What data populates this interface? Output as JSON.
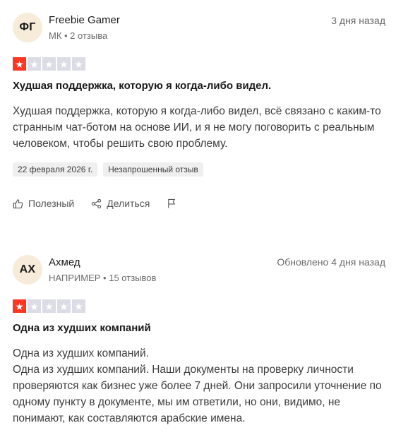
{
  "reviews": [
    {
      "avatar_initials": "ФГ",
      "name": "Freebie Gamer",
      "meta": "МК • 2 отзыва",
      "date": "3 дня назад",
      "rating": 1,
      "title": "Худшая поддержка, которую я когда-либо видел.",
      "body_lines": [
        "Худшая поддержка, которую я когда-либо видел, всё связано с каким-то странным чат-ботом на основе ИИ, и я не могу поговорить с реальным человеком, чтобы решить свою проблему."
      ],
      "tags": [
        "22 февраля 2026 г.",
        "Незапрошенный отзыв"
      ],
      "actions": {
        "useful": "Полезный",
        "share": "Делиться"
      }
    },
    {
      "avatar_initials": "АХ",
      "name": "Ахмед",
      "meta": "НАПРИМЕР • 15 отзывов",
      "date": "Обновлено 4 дня назад",
      "rating": 1,
      "title": "Одна из худших компаний",
      "body_lines": [
        "Одна из худших компаний.",
        "Одна из худших компаний. Наши документы на проверку личности проверяются как бизнес уже более 7 дней. Они запросили уточнение по одному пункту в документе, мы им ответили, но они, видимо, не понимают, как составляются арабские имена."
      ]
    }
  ],
  "colors": {
    "star_filled": "#ff3722",
    "star_empty": "#dcdce6",
    "tag_bg": "#efefef",
    "avatar_bg": "#f7ecd9"
  }
}
